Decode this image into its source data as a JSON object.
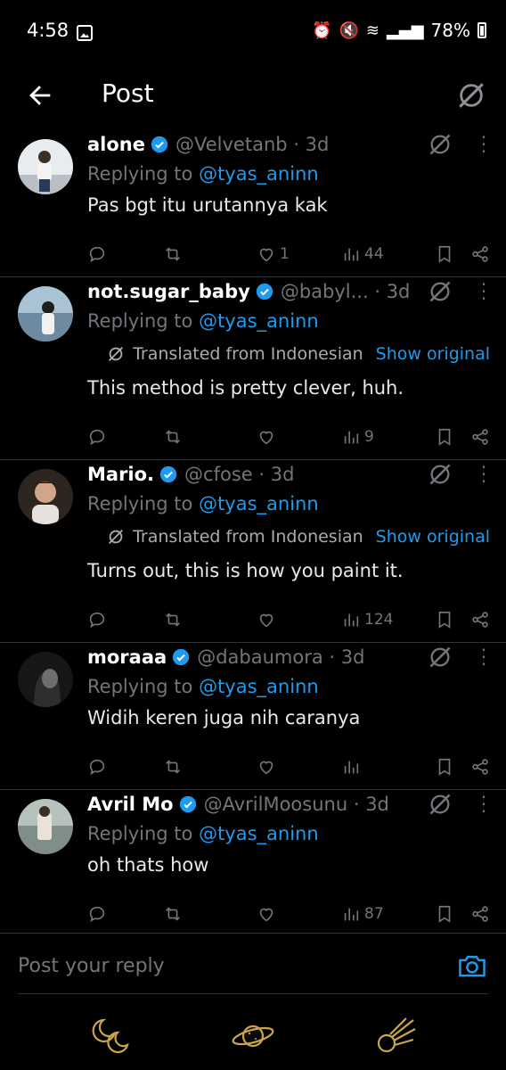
{
  "status_bar": {
    "time": "4:58",
    "battery": "78%"
  },
  "header": {
    "title": "Post"
  },
  "replies": [
    {
      "name": "alone",
      "handle": "@Velvetanb",
      "time": "· 3d",
      "replying_prefix": "Replying to ",
      "replying_to": "@tyas_aninn",
      "translated": false,
      "text": "Pas bgt itu urutannya kak",
      "likes": "1",
      "views": "44",
      "avatar_color": "#cfd6dc"
    },
    {
      "name": "not.sugar_baby",
      "handle": "@babyl...",
      "time": "· 3d",
      "replying_prefix": "Replying to ",
      "replying_to": "@tyas_aninn",
      "translated": true,
      "translated_label": "Translated from Indonesian",
      "show_original": "Show original",
      "text": "This method is pretty clever, huh.",
      "likes": "",
      "views": "9",
      "avatar_color": "#9fb6c6"
    },
    {
      "name": "Mario.",
      "handle": "@cfose",
      "time": "· 3d",
      "replying_prefix": "Replying to ",
      "replying_to": "@tyas_aninn",
      "translated": true,
      "translated_label": "Translated from Indonesian",
      "show_original": "Show original",
      "text": "Turns out, this is how you paint it.",
      "likes": "",
      "views": "124",
      "avatar_color": "#5b4a3f"
    },
    {
      "name": "moraaa",
      "handle": "@dabaumora",
      "time": "· 3d",
      "replying_prefix": "Replying to ",
      "replying_to": "@tyas_aninn",
      "translated": false,
      "text": "Widih keren juga nih caranya",
      "likes": "",
      "views": "",
      "avatar_color": "#2a2a2a"
    },
    {
      "name": "Avril Mo",
      "handle": "@AvrilMoosunu",
      "time": "· 3d",
      "replying_prefix": "Replying to ",
      "replying_to": "@tyas_aninn",
      "translated": false,
      "text": "oh thats how",
      "likes": "",
      "views": "87",
      "avatar_color": "#8b9b8f"
    }
  ],
  "composer": {
    "placeholder": "Post your reply"
  },
  "colors": {
    "accent": "#1d9bf0",
    "nav_gold": "#c9a64a"
  },
  "icons": [
    "back-arrow-icon",
    "grok-icon",
    "verified-icon",
    "reply-icon",
    "retweet-icon",
    "like-icon",
    "views-icon",
    "bookmark-icon",
    "share-icon",
    "camera-icon",
    "moon-icon",
    "planet-icon",
    "comet-icon"
  ]
}
